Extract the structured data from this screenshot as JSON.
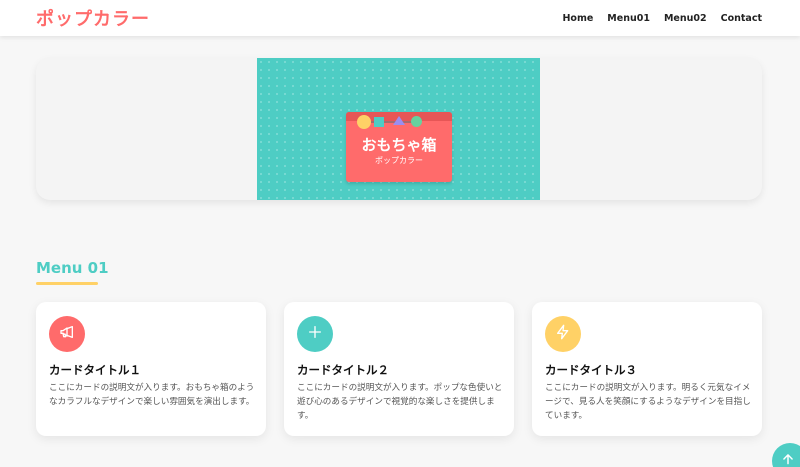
{
  "header": {
    "logo": "ポップカラー",
    "nav": [
      "Home",
      "Menu01",
      "Menu02",
      "Contact"
    ]
  },
  "hero": {
    "box_title": "おもちゃ箱",
    "box_subtitle": "ポップカラー"
  },
  "section": {
    "title": "Menu 01"
  },
  "cards": [
    {
      "icon": "megaphone-icon",
      "color": "#ff6b6b",
      "title": "カードタイトル１",
      "text": "ここにカードの説明文が入ります。おもちゃ箱のようなカラフルなデザインで楽しい雰囲気を演出します。"
    },
    {
      "icon": "plus-icon",
      "color": "#4ecdc4",
      "title": "カードタイトル２",
      "text": "ここにカードの説明文が入ります。ポップな色使いと遊び心のあるデザインで視覚的な楽しさを提供します。"
    },
    {
      "icon": "bolt-icon",
      "color": "#ffd166",
      "title": "カードタイトル３",
      "text": "ここにカードの説明文が入ります。明るく元気なイメージで、見る人を笑顔にするようなデザインを目指しています。"
    }
  ],
  "colors": {
    "primary": "#ff6b6b",
    "secondary": "#4ecdc4",
    "accent": "#ffd166"
  }
}
